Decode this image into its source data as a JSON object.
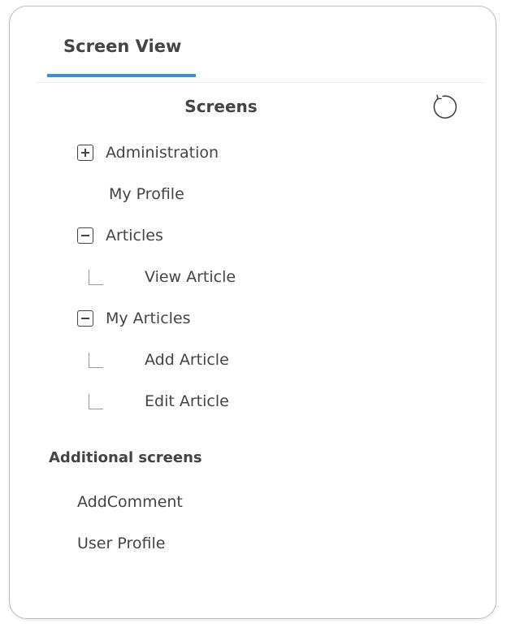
{
  "tabs": [
    {
      "label": "Screen View",
      "active": true
    }
  ],
  "screens": {
    "title": "Screens",
    "refresh_icon": "refresh-icon",
    "tree": [
      {
        "label": "Administration",
        "state": "collapsed"
      },
      {
        "label": "My Profile"
      },
      {
        "label": "Articles",
        "state": "expanded"
      },
      {
        "label": "View Article"
      },
      {
        "label": "My Articles",
        "state": "expanded"
      },
      {
        "label": "Add Article"
      },
      {
        "label": "Edit Article"
      }
    ]
  },
  "additional": {
    "title": "Additional screens",
    "items": [
      {
        "label": "AddComment"
      },
      {
        "label": "User Profile"
      }
    ]
  },
  "colors": {
    "accent": "#3a8fd4",
    "text": "#444444",
    "border": "#bdbdbd"
  }
}
